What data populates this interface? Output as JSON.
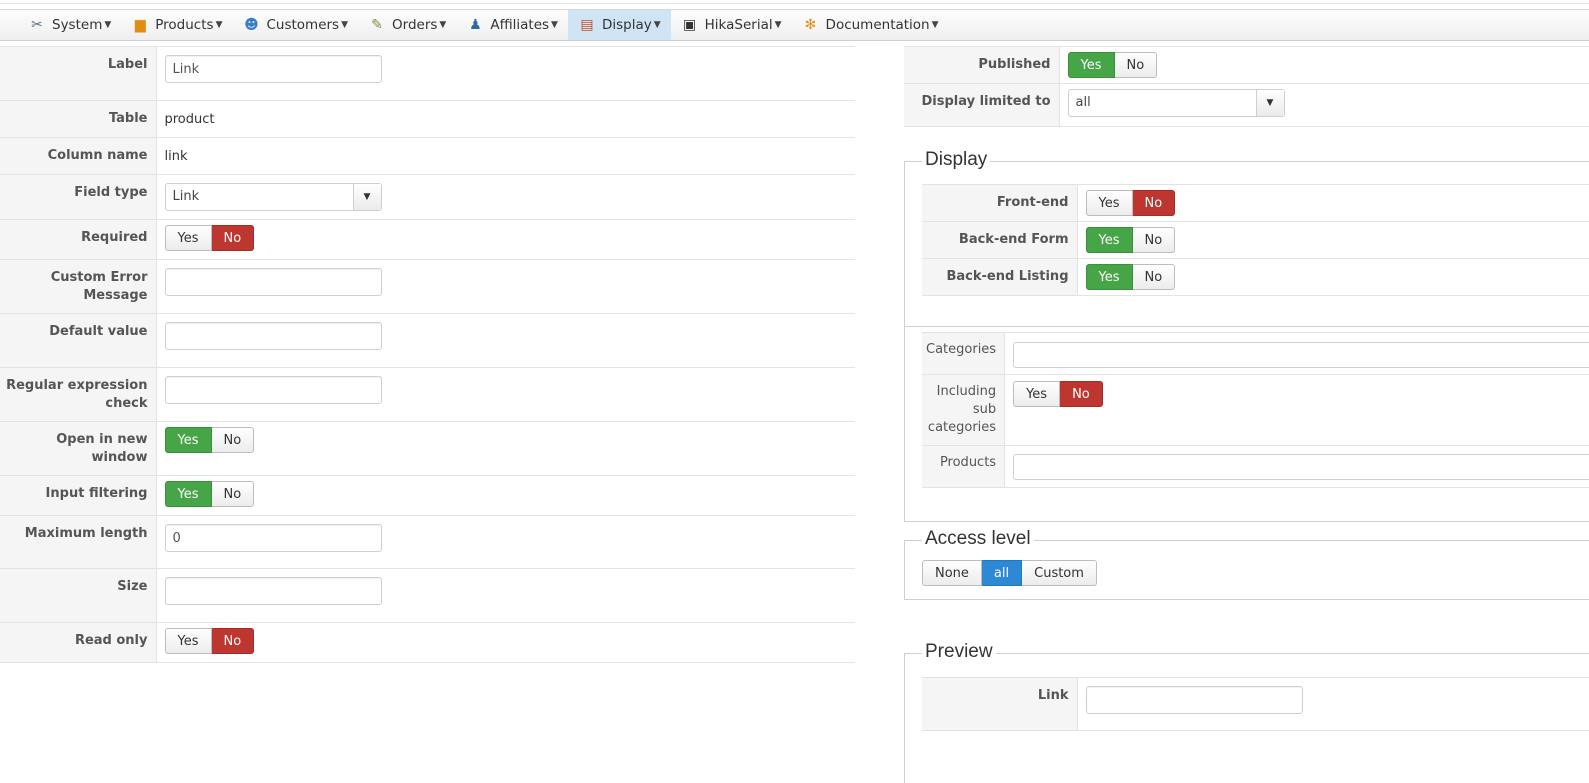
{
  "menu": {
    "items": [
      {
        "label": "System",
        "icon": "tools-icon"
      },
      {
        "label": "Products",
        "icon": "products-icon"
      },
      {
        "label": "Customers",
        "icon": "customers-icon"
      },
      {
        "label": "Orders",
        "icon": "orders-icon"
      },
      {
        "label": "Affiliates",
        "icon": "affiliates-icon"
      },
      {
        "label": "Display",
        "icon": "display-icon",
        "active": true
      },
      {
        "label": "HikaSerial",
        "icon": "serial-icon"
      },
      {
        "label": "Documentation",
        "icon": "documentation-icon"
      }
    ]
  },
  "form": {
    "label": {
      "label": "Label",
      "value": "Link"
    },
    "table": {
      "label": "Table",
      "value": "product"
    },
    "column_name": {
      "label": "Column name",
      "value": "link"
    },
    "field_type": {
      "label": "Field type",
      "value": "Link"
    },
    "required": {
      "label": "Required",
      "yes": "Yes",
      "no": "No",
      "selected": "No"
    },
    "custom_error": {
      "label": "Custom Error Message",
      "value": ""
    },
    "default_value": {
      "label": "Default value",
      "value": ""
    },
    "regex": {
      "label": "Regular expression check",
      "value": ""
    },
    "open_new_window": {
      "label": "Open in new window",
      "yes": "Yes",
      "no": "No",
      "selected": "Yes"
    },
    "input_filtering": {
      "label": "Input filtering",
      "yes": "Yes",
      "no": "No",
      "selected": "Yes"
    },
    "max_length": {
      "label": "Maximum length",
      "value": "0"
    },
    "size": {
      "label": "Size",
      "value": ""
    },
    "read_only": {
      "label": "Read only",
      "yes": "Yes",
      "no": "No",
      "selected": "No"
    }
  },
  "right": {
    "published": {
      "label": "Published",
      "yes": "Yes",
      "no": "No",
      "selected": "Yes"
    },
    "display_limited": {
      "label": "Display limited to",
      "value": "all"
    },
    "display_section": {
      "title": "Display",
      "front_end": {
        "label": "Front-end",
        "yes": "Yes",
        "no": "No",
        "selected": "No"
      },
      "backend_form": {
        "label": "Back-end Form",
        "yes": "Yes",
        "no": "No",
        "selected": "Yes"
      },
      "backend_listing": {
        "label": "Back-end Listing",
        "yes": "Yes",
        "no": "No",
        "selected": "Yes"
      }
    },
    "categories_section": {
      "categories_label": "Categories",
      "including_sub_label": "Including sub categories",
      "including_sub_yes": "Yes",
      "including_sub_no": "No",
      "products_label": "Products"
    },
    "access_level": {
      "title": "Access level",
      "none": "None",
      "all": "all",
      "custom": "Custom",
      "selected": "all"
    },
    "preview": {
      "title": "Preview",
      "link_label": "Link",
      "link_value": ""
    }
  },
  "colors": {
    "yes_active": "#46a546",
    "no_active": "#bd362f",
    "blue_active": "#2d89d6",
    "menu_active_bg": "#cfe5f5"
  }
}
